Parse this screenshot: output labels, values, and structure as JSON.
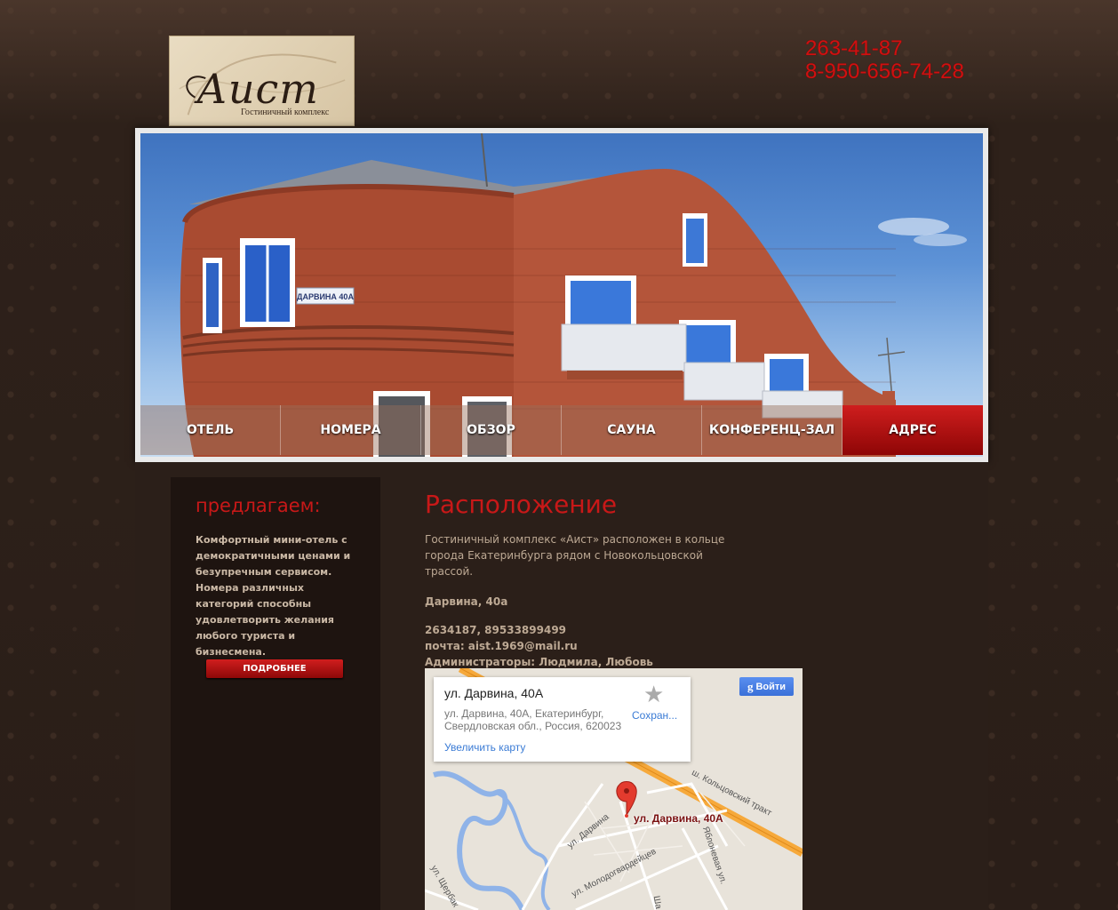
{
  "header": {
    "logo_name": "Аист",
    "logo_subtitle": "Гостиничный комплекс",
    "phones": [
      "263-41-87",
      "8-950-656-74-28"
    ]
  },
  "hero": {
    "sign_text": "ДАРВИНА 40А"
  },
  "nav": {
    "items": [
      {
        "label": "ОТЕЛЬ",
        "active": false
      },
      {
        "label": "НОМЕРА",
        "active": false
      },
      {
        "label": "ОБЗОР",
        "active": false
      },
      {
        "label": "САУНА",
        "active": false
      },
      {
        "label": "КОНФЕРЕНЦ-ЗАЛ",
        "active": false
      },
      {
        "label": "АДРЕС",
        "active": true
      }
    ],
    "active_color": "#b31212"
  },
  "sidebar": {
    "title": "предлагаем:",
    "text": "Комфортный мини-отель с демократичными ценами и безупречным сервисом. Номера различных категорий способны удовлетворить желания любого туриста и бизнесмена.",
    "button_label": "ПОДРОБНЕЕ"
  },
  "main": {
    "title": "Расположение",
    "intro": "Гостиничный комплекс «Аист» расположен в кольце города Екатеринбурга рядом с Новокольцовской трассой.",
    "address": "Дарвина, 40а",
    "contacts": [
      "2634187, 89533899499",
      "почта: aist.1969@mail.ru",
      "Администраторы: Людмила, Любовь"
    ]
  },
  "map": {
    "card_title": "ул. Дарвина, 40А",
    "card_address_line1": "ул. Дарвина, 40А, Екатеринбург,",
    "card_address_line2": "Свердловская обл., Россия, 620023",
    "save_label": "Сохран...",
    "enlarge_label": "Увеличить карту",
    "signin_label": "Войти",
    "marker_label": "ул. Дарвина, 40А",
    "street_labels": {
      "koltsovsky": "ш. Кольцовский тракт",
      "darvina": "ул. Дарвина",
      "molodogvardeytsev": "ул. Молодогвардейцев",
      "yablonevaya": "Яблоневая ул.",
      "shcherbakova": "ул. Щербак",
      "sha": "Ша"
    }
  },
  "colors": {
    "accent_red": "#c81818",
    "phone_red": "#d01010",
    "sidebar_bg": "#1e1410",
    "content_bg": "#2b1f19",
    "text_beige": "#bda994"
  }
}
